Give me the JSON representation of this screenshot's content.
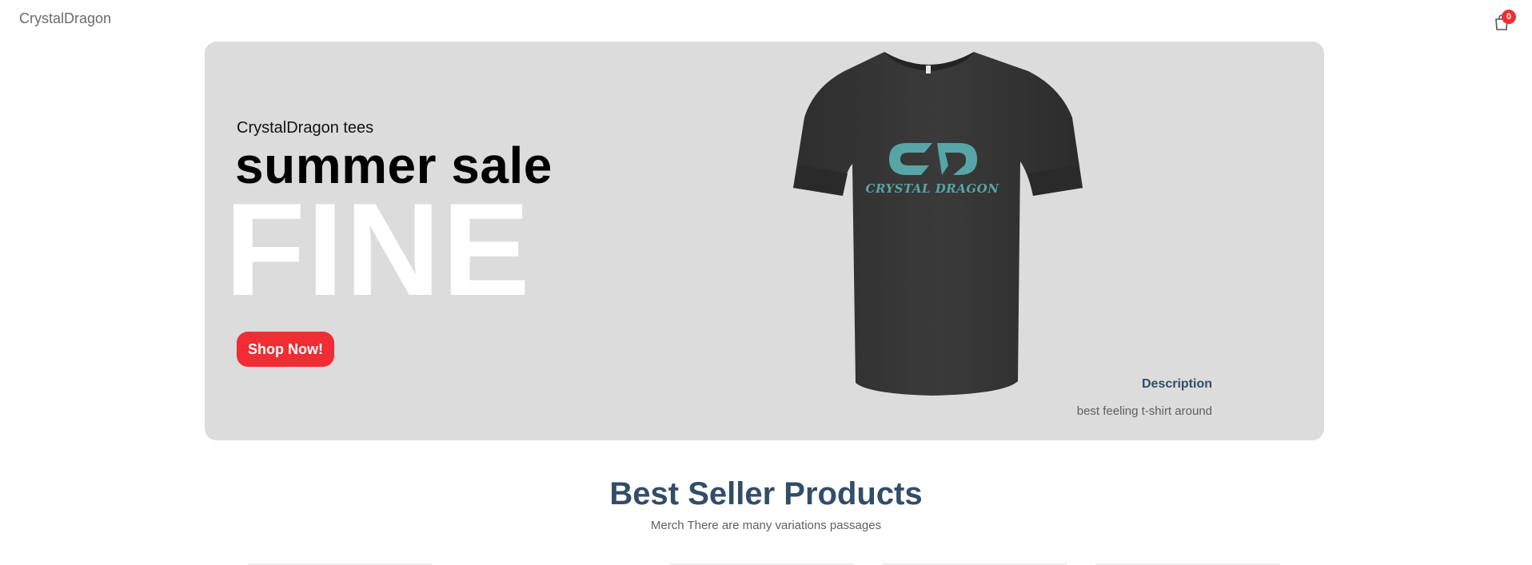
{
  "navbar": {
    "logo": "CrystalDragon",
    "cart_count": "0",
    "cart_icon": "shopping-bag-icon"
  },
  "hero": {
    "small_text": "CrystalDragon tees",
    "mid_text": "summer sale",
    "large_text": "FINE",
    "button_label": "Shop Now!",
    "image": {
      "desc": "dark heather t-shirt",
      "logo_text": "CRYSTAL DRAGON",
      "logo_color": "#57a5a6"
    },
    "description_title": "Description",
    "description_text": "best feeling t-shirt around"
  },
  "best_seller": {
    "heading": "Best Seller Products",
    "subheading": "Merch There are many variations passages"
  },
  "colors": {
    "accent": "#f02d34",
    "hero_bg": "#dcdcdc",
    "heading": "#324d67"
  }
}
